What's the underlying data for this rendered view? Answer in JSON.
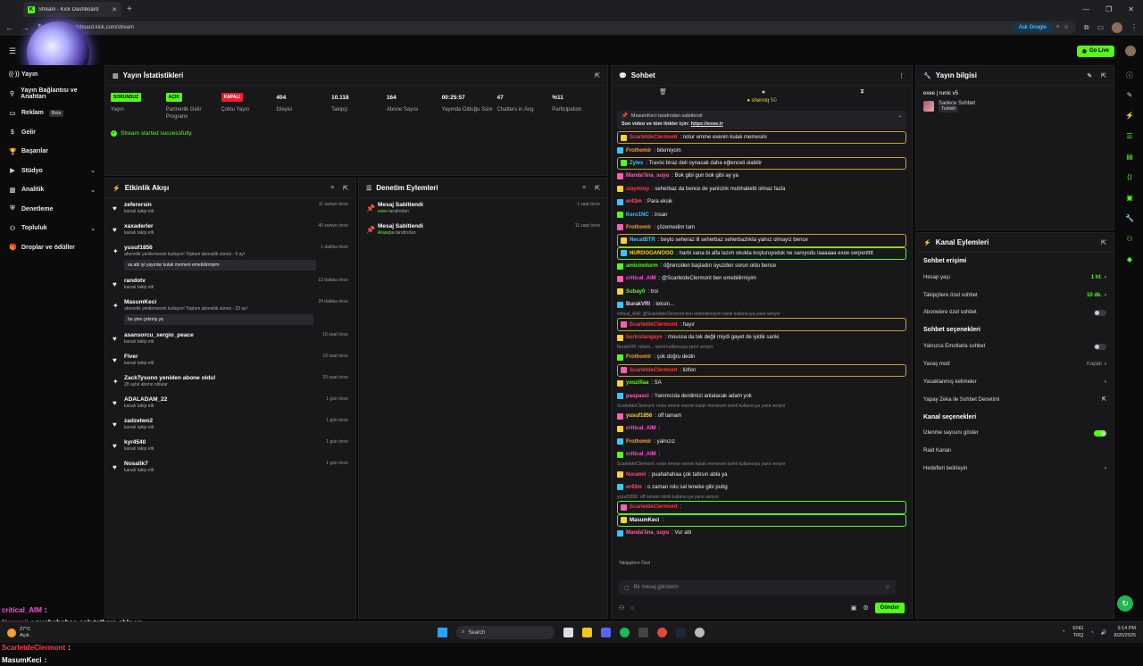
{
  "browser": {
    "tab_title": "Stream - Kick Dashboard",
    "url": "dashboard.kick.com/stream",
    "ask_google": "Ask Google"
  },
  "topbar": {
    "go_live": "Go Live"
  },
  "sidebar": {
    "items": [
      {
        "label": "Yayın",
        "icon": "broadcast-icon"
      },
      {
        "label": "Yayın Bağlantısı ve Anahtarı",
        "icon": "link-icon"
      },
      {
        "label": "Reklam",
        "icon": "ad-icon",
        "badge": "Beta"
      },
      {
        "label": "Gelir",
        "icon": "money-icon"
      },
      {
        "label": "Başarılar",
        "icon": "trophy-icon"
      },
      {
        "label": "Stüdyo",
        "icon": "studio-icon",
        "chevron": true
      },
      {
        "label": "Analitik",
        "icon": "chart-icon",
        "chevron": true
      },
      {
        "label": "Denetleme",
        "icon": "shield-icon"
      },
      {
        "label": "Topluluk",
        "icon": "community-icon",
        "chevron": true
      },
      {
        "label": "Droplar ve ödüller",
        "icon": "gift-icon"
      }
    ],
    "overlay_chat": [
      {
        "user": "critical_AIM",
        "msg": ":",
        "color": "#ff4fd8"
      },
      {
        "user": "Noramii",
        "msg": ": puahahahaa çok tatlısın abla ya",
        "color": "#ff4f6a"
      },
      {
        "user": "er43m",
        "msg": ": o zaman rolu sal teneke gibi pubg",
        "color": "#ff4f6a"
      },
      {
        "user": "ScarletdeClermont",
        "msg": ":",
        "color": "#ff3b3b"
      },
      {
        "user": "MasumKeci",
        "msg": ":",
        "color": "#ffffff"
      }
    ]
  },
  "stats_panel": {
    "title": "Yayın İstatistikleri",
    "stats": [
      {
        "value": "SORUNSUZ",
        "label": "Yayın",
        "pill": "#53fc18"
      },
      {
        "value": "AÇIK",
        "label": "Partnerlik Gelir Programı",
        "pill": "#53fc18"
      },
      {
        "value": "KAPALI",
        "label": "Çoklu Yayın",
        "pill": "#e91e2f"
      },
      {
        "value": "404",
        "label": "İzleyici"
      },
      {
        "value": "10.118",
        "label": "Takipçi"
      },
      {
        "value": "164",
        "label": "Abone Sayısı"
      },
      {
        "value": "00:25:57",
        "label": "Yayında Olduğu Süre"
      },
      {
        "value": "47",
        "label": "Chatters in Avg."
      },
      {
        "value": "%11",
        "label": "Participation"
      }
    ],
    "status": "Stream started successfully."
  },
  "activity": {
    "title": "Etkinlik Akışı",
    "items": [
      {
        "icon": "heart-icon",
        "name": "zeferersin",
        "sub": "kanalı takip etti",
        "time": "11 saniye önce"
      },
      {
        "icon": "heart-icon",
        "name": "xaxaderler",
        "sub": "kanalı takip etti",
        "time": "40 saniye önce"
      },
      {
        "icon": "star-icon",
        "name": "yusuf1856",
        "sub": "abonelik yenilemesini kutluyor! Toplam abonelik süresi - 9 ay!",
        "time": "1 dakika önce",
        "msg": "sa abi iyi yayınlar kulak memeni emebilirmiyim"
      },
      {
        "icon": "heart-icon",
        "name": "randotv",
        "sub": "kanalı takip etti",
        "time": "13 dakika önce"
      },
      {
        "icon": "star-icon",
        "name": "MasumKeci",
        "sub": "abonelik yenilemesini kutluyor! Toplam abonelik süresi - 23 ay!",
        "time": "24 dakika önce",
        "msg": "bu yine çekmiş ya"
      },
      {
        "icon": "heart-icon",
        "name": "asansorcu_sergio_peace",
        "sub": "kanalı takip etti",
        "time": "16 saat önce"
      },
      {
        "icon": "heart-icon",
        "name": "Flver",
        "sub": "kanalı takip etti",
        "time": "19 saat önce"
      },
      {
        "icon": "star-icon",
        "name": "ZackTysonn yeniden abone oldu!",
        "sub": "28 aylık abone oldular",
        "time": "20 saat önce"
      },
      {
        "icon": "heart-icon",
        "name": "ADALADAM_22",
        "sub": "kanalı takip etti",
        "time": "1 gün önce"
      },
      {
        "icon": "heart-icon",
        "name": "zadzelwo2",
        "sub": "kanalı takip etti",
        "time": "1 gün önce"
      },
      {
        "icon": "heart-icon",
        "name": "kyr4540",
        "sub": "kanalı takip etti",
        "time": "1 gün önce"
      },
      {
        "icon": "heart-icon",
        "name": "Nosalik7",
        "sub": "kanalı takip etti",
        "time": "1 gün önce"
      }
    ]
  },
  "moderation": {
    "title": "Denetim Eylemleri",
    "items": [
      {
        "name": "Mesaj Sabitlendi",
        "by": "exee",
        "suffix": "tarafından",
        "time": "1 saat önce"
      },
      {
        "name": "Mesaj Sabitlendi",
        "by": "Arasepa",
        "suffix": "tarafından",
        "time": "11 saat önce"
      }
    ]
  },
  "chat": {
    "title": "Sohbet",
    "top_user": "shennq",
    "top_count": "50",
    "pinned_by": "MasumKeci tarafından sabitlendi",
    "pinned_text": "Son video ve tüm linkler için:",
    "pinned_link": "https://exee.tr",
    "messages": [
      {
        "u": "ScarletdeClermont",
        "c": "#ff3b3b",
        "m": ": nolur emme exenin kulak memesini",
        "style": "hl"
      },
      {
        "u": "Frothomir",
        "c": "#ff9f2f",
        "m": ": bilemiyom"
      },
      {
        "u": "Zyles",
        "c": "#36c6ff",
        "m": ": Travisi biraz deli oynasak daha eğlenceli olabilir",
        "style": "hl"
      },
      {
        "u": "Manda'lina_suyu",
        "c": "#ff5fb0",
        "m": ": Bok gibi gun bok gibi ay ya"
      },
      {
        "u": "slaymiop",
        "c": "#ff3b3b",
        "m": ": seherbaz da bence de yanlızlık muhhabetti olmaz fazla"
      },
      {
        "u": "er43m",
        "c": "#ff4f6a",
        "m": ": Para eksik"
      },
      {
        "u": "Kero1NC",
        "c": "#36c6ff",
        "m": ": insan"
      },
      {
        "u": "Frothomir",
        "c": "#ff9f2f",
        "m": ": çözemedim tam"
      },
      {
        "u": "NecatBTR",
        "c": "#36c6ff",
        "m": ": beyto seheraz ill seherbaz seherbazlıkta yalnız olmayız bence",
        "style": "hl"
      },
      {
        "u": "NURDOGANOOO",
        "c": "#ffd22f",
        "m": ": harbi sana bi alfa lazım okulda koşturuyoduk ne sanıyodu laaaaaa exee serpentttt",
        "style": "gr"
      },
      {
        "u": "amicinolurm",
        "c": "#53fc18",
        "m": ": öğrenciden başladın oyuzden sorun oldu bence"
      },
      {
        "u": "critical_AIM",
        "c": "#ff4fd8",
        "m": ": @ScarletdeClermont ben emebilirmiyim"
      },
      {
        "u": "Subay0",
        "c": "#53fc18",
        "m": ": troi"
      },
      {
        "u": "BurakVRI",
        "c": "#dddddd",
        "m": ": teksin..."
      },
      {
        "reply": "critical_AIM: @ScarletdeClermont ben emebilirmiyim isimli kullanıcıya yanıt veriyor"
      },
      {
        "u": "ScarletdeClermont",
        "c": "#ff3b3b",
        "m": ": hayır",
        "style": "hl"
      },
      {
        "u": "burkistangaye",
        "c": "#ff3b3b",
        "m": ": moussa da tek değil miydi gayet de iyidik sanki"
      },
      {
        "reply": "BurakVRI: teksin... isimli kullanıcıya yanıt veriyor"
      },
      {
        "u": "Frothomir",
        "c": "#ff9f2f",
        "m": ": çok doğru dedin"
      },
      {
        "u": "ScarletdeClermont",
        "c": "#ff3b3b",
        "m": ": lütfen",
        "style": "hl"
      },
      {
        "u": "youzillaa",
        "c": "#53fc18",
        "m": ": SA"
      },
      {
        "u": "paspasci",
        "c": "#ff5fb0",
        "m": ": Yanımızda derdimizi anlatacak adam yok"
      },
      {
        "reply": "ScarletdeClermont: nolur emme exenin kulak memesini isimli kullanıcıya yanıt veriyor"
      },
      {
        "u": "yusuf1856",
        "c": "#ffd22f",
        "m": ": off tamam"
      },
      {
        "u": "critical_AIM",
        "c": "#ff4fd8",
        "m": ":"
      },
      {
        "u": "Frothomir",
        "c": "#ff9f2f",
        "m": ": yalnızız"
      },
      {
        "u": "critical_AIM",
        "c": "#ff4fd8",
        "m": ":"
      },
      {
        "reply": "ScarletdeClermont: nolur emme exenin kulak memesini isimli kullanıcıya yanıt veriyor"
      },
      {
        "u": "Noramii",
        "c": "#ff4f6a",
        "m": ": puahahahaa çok tatlısın abla ya"
      },
      {
        "u": "er43m",
        "c": "#ff4f6a",
        "m": ": o zaman rolu sal teneke gibi pubg"
      },
      {
        "reply": "yusuf1856: off tamam isimli kullanıcıya yanıt veriyor"
      },
      {
        "u": "ScarletdeClermont",
        "c": "#ff3b3b",
        "m": ":",
        "style": "gr"
      },
      {
        "u": "MasumKeci",
        "c": "#ffffff",
        "m": ":",
        "style": "gr"
      },
      {
        "u": "Manda'lina_suyu",
        "c": "#ff5fb0",
        "m": ": Vur abi"
      }
    ],
    "followers_only": "Takipçilere Özel",
    "placeholder": "Bir mesaj gönderin",
    "send": "Gönder"
  },
  "stream_info": {
    "title": "Yayın bilgisi",
    "stream_title": "exee | runic v5",
    "category": "Sadece Sohbet",
    "tag": "Turkish"
  },
  "channel_actions": {
    "title": "Kanal Eylemleri",
    "chat_access": "Sohbet erişimi",
    "rows1": [
      {
        "label": "Hesap yaşı",
        "value": "1 hf.",
        "type": "chevron"
      },
      {
        "label": "Takipçilere özel sohbet",
        "value": "10 dk.",
        "type": "chevron"
      },
      {
        "label": "Abonelere özel sohbet",
        "type": "toggle-off"
      }
    ],
    "chat_options": "Sohbet seçenekleri",
    "rows2": [
      {
        "label": "Yalnızca Emotlarla sohbet",
        "type": "toggle-off"
      },
      {
        "label": "Yavaş mod",
        "value": "Kapalı",
        "type": "chevron-grey"
      },
      {
        "label": "Yasaklanmış kelimeler",
        "type": "chevron"
      },
      {
        "label": "Yapay Zeka ile Sohbet Denetimi",
        "type": "external"
      }
    ],
    "channel_options": "Kanal seçenekleri",
    "rows3": [
      {
        "label": "İzlenme sayısını göster",
        "type": "toggle-on"
      },
      {
        "label": "Raid Kanalı",
        "type": "none"
      },
      {
        "label": "Hedefleri belirleyin",
        "type": "chevron"
      }
    ]
  },
  "taskbar": {
    "temp": "27°C",
    "weather": "Açık",
    "search": "Search",
    "lang1": "ENG",
    "lang2": "TRQ",
    "time": "9:14 PM",
    "date": "8/20/2025"
  }
}
